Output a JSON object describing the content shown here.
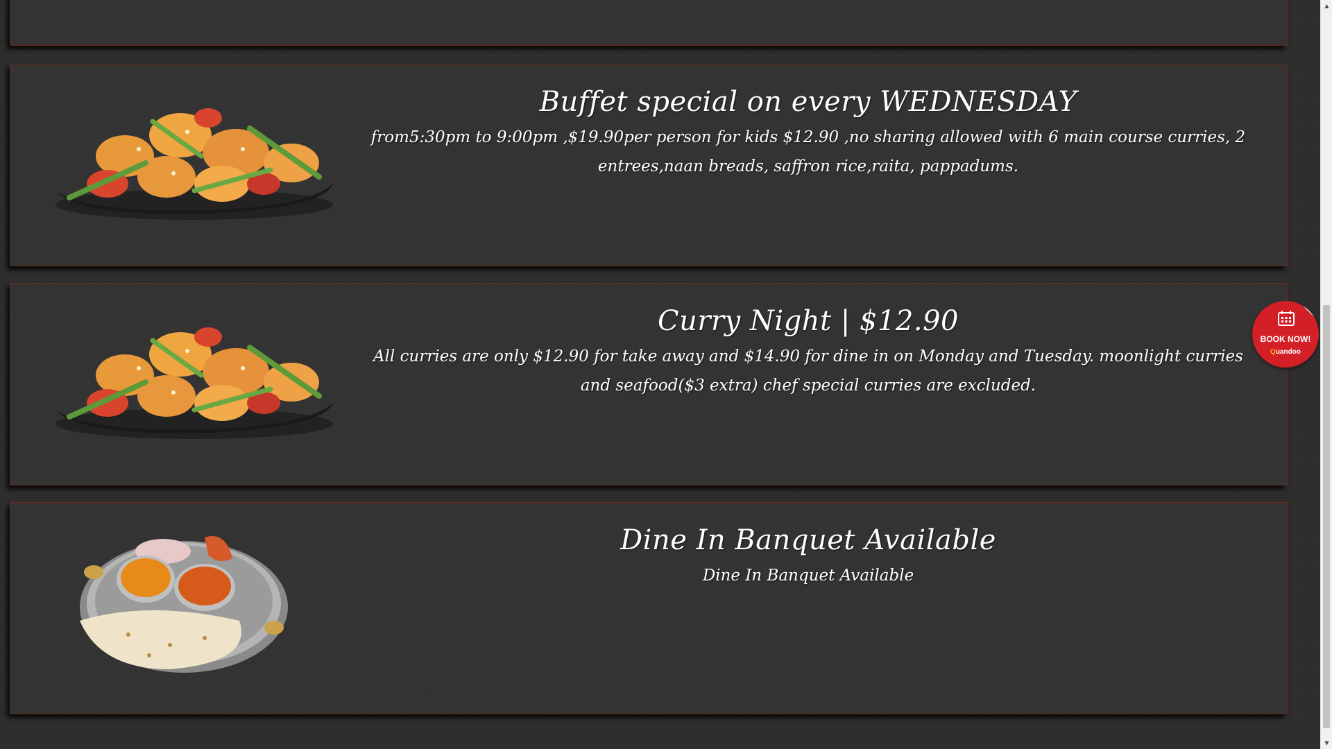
{
  "promotions": [
    {
      "title": "Buffet special on every WEDNESDAY",
      "description": "from5:30pm to 9:00pm ,$19.90per person for kids $12.90 ,no sharing allowed with 6 main course curries, 2 entrees,naan breads, saffron rice,raita, pappadums.",
      "image": "shrimp-stir-fry-dish"
    },
    {
      "title": "Curry Night | $12.90",
      "description": "All curries are only $12.90 for take away and $14.90 for dine in on Monday and Tuesday. moonlight curries and seafood($3 extra) chef special curries are excluded.",
      "image": "shrimp-stir-fry-dish"
    },
    {
      "title": "Dine In Banquet Available",
      "description": "Dine In Banquet Available",
      "image": "curry-naan-platter"
    }
  ],
  "book_widget": {
    "label": "BOOK NOW!",
    "brand_initial": "Q",
    "brand_rest": "uandoo",
    "icon": "calendar-icon",
    "color": "#d31f26"
  },
  "scrollbar": {
    "up": "▲",
    "down": "▼"
  },
  "colors": {
    "panel_border": "#6b2a16",
    "text": "#ffffff",
    "background": "#2d2d2d"
  }
}
